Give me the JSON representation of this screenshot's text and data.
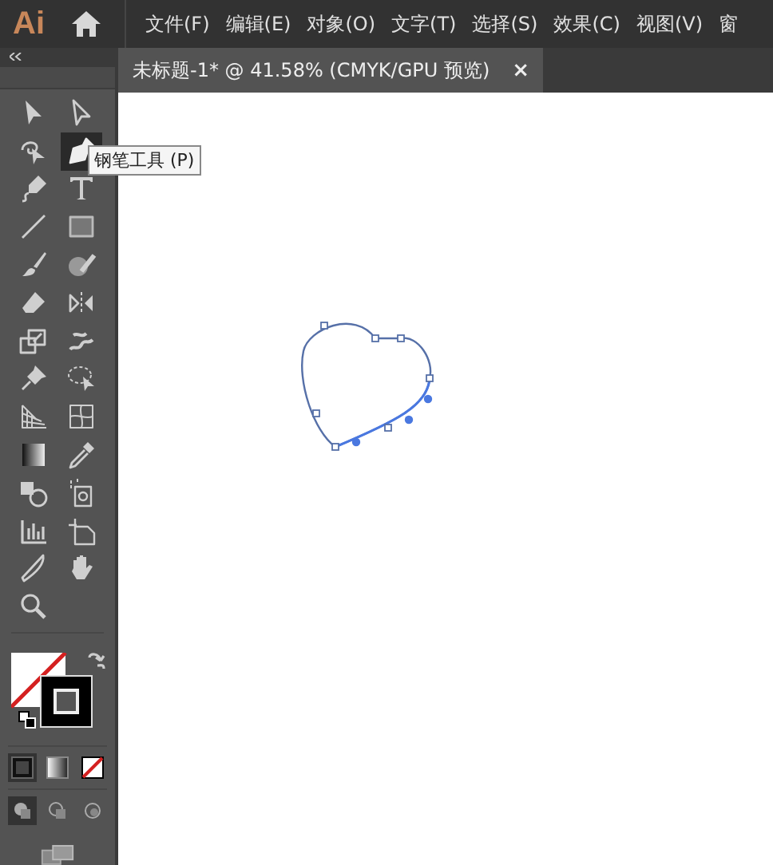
{
  "app": {
    "logo": "Ai"
  },
  "menu": [
    "文件(F)",
    "编辑(E)",
    "对象(O)",
    "文字(T)",
    "选择(S)",
    "效果(C)",
    "视图(V)",
    "窗"
  ],
  "tab": {
    "title": "未标题-1* @ 41.58% (CMYK/GPU 预览)",
    "close": "×"
  },
  "tools": [
    {
      "kind": "select",
      "selected": false
    },
    {
      "kind": "direct",
      "selected": false
    },
    {
      "kind": "curvature",
      "selected": false
    },
    {
      "kind": "pen",
      "selected": true
    },
    {
      "kind": "blob",
      "selected": false
    },
    {
      "kind": "type",
      "selected": false
    },
    {
      "kind": "line",
      "selected": false
    },
    {
      "kind": "rect",
      "selected": false
    },
    {
      "kind": "brush",
      "selected": false
    },
    {
      "kind": "shaper",
      "selected": false
    },
    {
      "kind": "eraser",
      "selected": false
    },
    {
      "kind": "reflect",
      "selected": false
    },
    {
      "kind": "scale",
      "selected": false
    },
    {
      "kind": "warp",
      "selected": false
    },
    {
      "kind": "pin",
      "selected": false
    },
    {
      "kind": "lasso",
      "selected": false
    },
    {
      "kind": "perspective",
      "selected": false
    },
    {
      "kind": "mesh",
      "selected": false
    },
    {
      "kind": "gradient",
      "selected": false
    },
    {
      "kind": "eyedropper",
      "selected": false
    },
    {
      "kind": "shapebuilder",
      "selected": false
    },
    {
      "kind": "symbol",
      "selected": false
    },
    {
      "kind": "graph",
      "selected": false
    },
    {
      "kind": "artboard",
      "selected": false
    },
    {
      "kind": "knife",
      "selected": false
    },
    {
      "kind": "hand",
      "selected": false
    },
    {
      "kind": "zoom",
      "selected": false
    }
  ],
  "tooltip": "钢笔工具 (P)",
  "color_modes": [
    {
      "kind": "color",
      "selected": true
    },
    {
      "kind": "gradient",
      "selected": false
    },
    {
      "kind": "none",
      "selected": false
    }
  ],
  "draw_modes": [
    {
      "kind": "normal",
      "selected": true
    },
    {
      "kind": "behind",
      "selected": false
    },
    {
      "kind": "inside",
      "selected": false
    }
  ]
}
